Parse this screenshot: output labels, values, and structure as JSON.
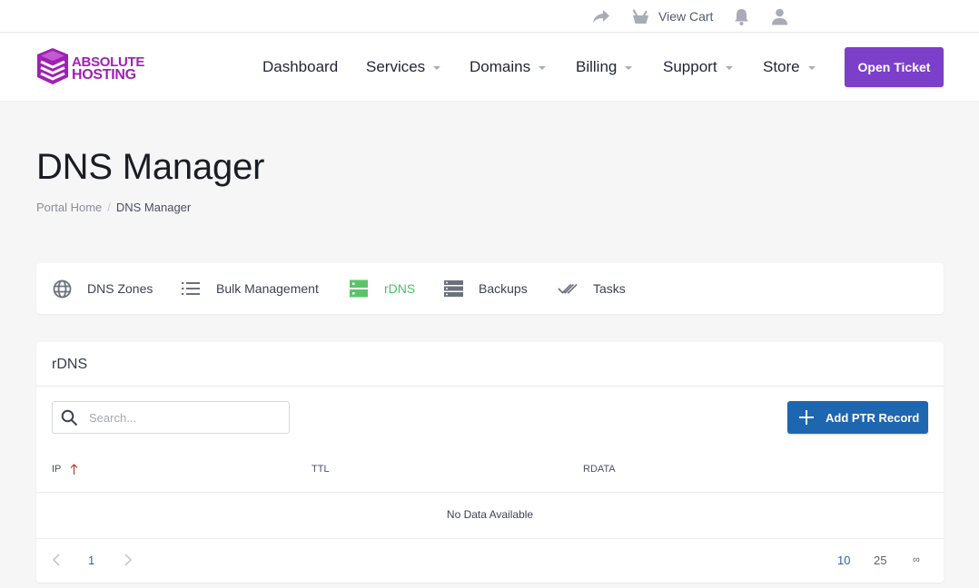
{
  "topbar": {
    "share_icon": "share-arrow-icon",
    "cart_icon": "basket-icon",
    "cart_label": "View Cart",
    "notifications_icon": "bell-icon",
    "account_icon": "user-icon"
  },
  "brand": {
    "logo_icon": "stacked-server-icon",
    "line1": "ABSOLUTE",
    "line2": "HOSTING",
    "color": "#a020b4"
  },
  "nav": {
    "items": [
      {
        "label": "Dashboard",
        "has_dropdown": false
      },
      {
        "label": "Services",
        "has_dropdown": true
      },
      {
        "label": "Domains",
        "has_dropdown": true
      },
      {
        "label": "Billing",
        "has_dropdown": true
      },
      {
        "label": "Support",
        "has_dropdown": true
      },
      {
        "label": "Store",
        "has_dropdown": true
      }
    ],
    "cta_label": "Open Ticket",
    "cta_color": "#7b3fc9"
  },
  "page": {
    "title": "DNS Manager",
    "breadcrumb": [
      {
        "label": "Portal Home"
      },
      {
        "label": "DNS Manager"
      }
    ]
  },
  "tabs": [
    {
      "label": "DNS Zones",
      "icon": "globe-icon",
      "active": false
    },
    {
      "label": "Bulk Management",
      "icon": "list-icon",
      "active": false
    },
    {
      "label": "rDNS",
      "icon": "server-icon",
      "active": true
    },
    {
      "label": "Backups",
      "icon": "storage-icon",
      "active": false
    },
    {
      "label": "Tasks",
      "icon": "double-check-icon",
      "active": false
    }
  ],
  "active_color": "#4cbf63",
  "rdns": {
    "title": "rDNS",
    "search_placeholder": "Search...",
    "search_value": "",
    "add_button_label": "Add PTR Record",
    "add_button_color": "#1f66b1",
    "columns": [
      {
        "label": "IP",
        "sort": "ascending"
      },
      {
        "label": "TTL"
      },
      {
        "label": "RDATA"
      }
    ],
    "rows": [],
    "empty_text": "No Data Available",
    "pagination": {
      "current_page": "1",
      "page_sizes": [
        "10",
        "25",
        "∞"
      ],
      "selected_page_size": "10"
    }
  }
}
